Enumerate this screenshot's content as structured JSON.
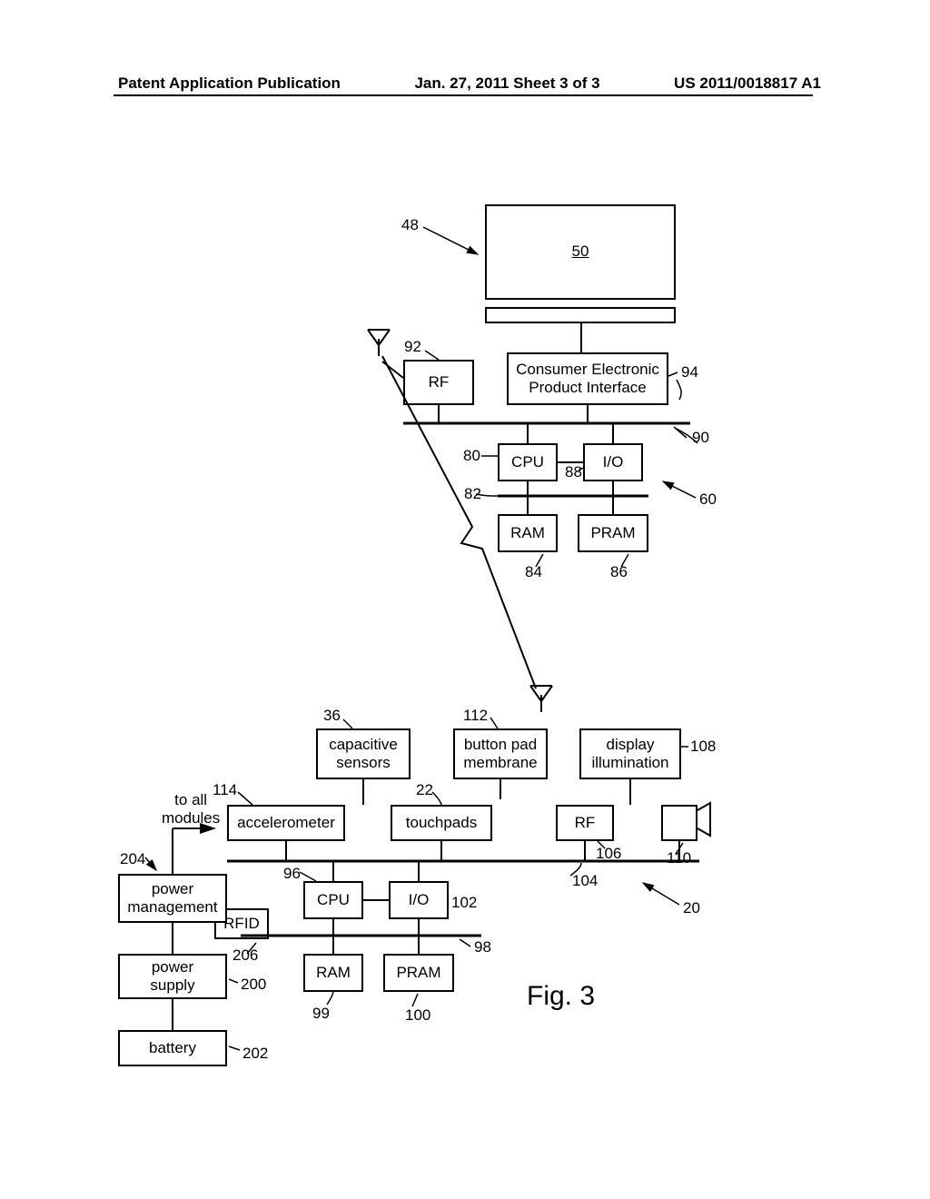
{
  "header": {
    "left": "Patent Application Publication",
    "center": "Jan. 27, 2011  Sheet 3 of 3",
    "right": "US 2011/0018817 A1"
  },
  "upper": {
    "display_ref": "50",
    "rf": "RF",
    "cep": "Consumer Electronic\nProduct Interface",
    "cpu": "CPU",
    "io": "I/O",
    "ram": "RAM",
    "pram": "PRAM"
  },
  "lower": {
    "cap": "capacitive\nsensors",
    "bpm": "button pad\nmembrane",
    "disp_illum": "display\nillumination",
    "accel": "accelerometer",
    "touchpads": "touchpads",
    "rf": "RF",
    "cpu": "CPU",
    "io": "I/O",
    "rfid": "RFID",
    "ram": "RAM",
    "pram": "PRAM",
    "pwr_mgmt": "power\nmanagement",
    "pwr_supply": "power\nsupply",
    "battery": "battery",
    "to_all": "to all\nmodules"
  },
  "refs": {
    "r48": "48",
    "r50": "50",
    "r92": "92",
    "r94": "94",
    "r90": "90",
    "r80": "80",
    "r88": "88",
    "r82": "82",
    "r84": "84",
    "r86": "86",
    "r60": "60",
    "r36": "36",
    "r112": "112",
    "r108": "108",
    "r114": "114",
    "r22": "22",
    "r106": "106",
    "r110": "110",
    "r96": "96",
    "r102": "102",
    "r104": "104",
    "r20": "20",
    "r204": "204",
    "r206": "206",
    "r98": "98",
    "r200": "200",
    "r99": "99",
    "r100": "100",
    "r202": "202"
  },
  "figure": "Fig. 3"
}
